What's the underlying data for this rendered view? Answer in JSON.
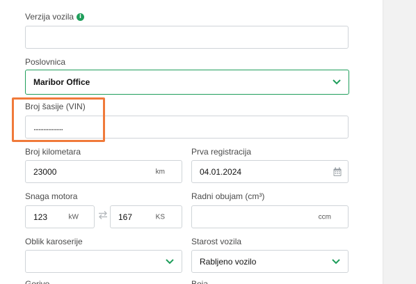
{
  "form": {
    "vehicle_version": {
      "label": "Verzija vozila",
      "value": "",
      "info_icon": "info-icon"
    },
    "branch": {
      "label": "Poslovnica",
      "value": "Maribor Office",
      "icon": "chevron-down-icon"
    },
    "vin": {
      "label": "Broj šasije (VIN)",
      "value": "..................",
      "masked": true
    },
    "mileage": {
      "label": "Broj kilometara",
      "value": "23000",
      "unit": "km"
    },
    "first_registration": {
      "label": "Prva registracija",
      "value": "04.01.2024",
      "icon": "calendar-icon"
    },
    "engine_power": {
      "label": "Snaga motora",
      "kw_value": "123",
      "kw_unit": "kW",
      "ks_value": "167",
      "ks_unit": "KS",
      "icon": "swap-arrows-icon"
    },
    "displacement": {
      "label": "Radni obujam (cm³)",
      "value": "",
      "unit": "ccm"
    },
    "body_type": {
      "label": "Oblik karoserije",
      "value": "",
      "icon": "chevron-down-icon"
    },
    "vehicle_age": {
      "label": "Starost vozila",
      "value": "Rabljeno vozilo",
      "icon": "chevron-down-icon"
    }
  },
  "colors": {
    "accent": "#1f9e5b",
    "highlight": "#f07a3a",
    "border": "#cfd4d8"
  }
}
